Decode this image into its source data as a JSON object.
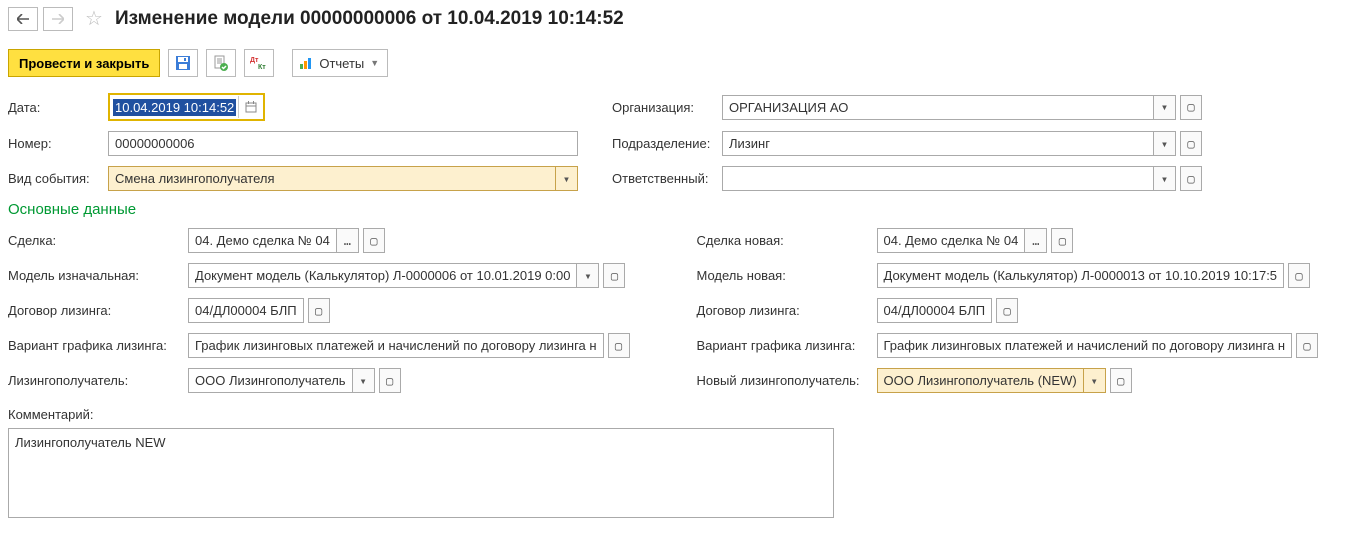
{
  "title": "Изменение модели 00000000006 от 10.04.2019 10:14:52",
  "toolbar": {
    "post_close": "Провести и закрыть",
    "reports": "Отчеты"
  },
  "top": {
    "date_label": "Дата:",
    "date_value": "10.04.2019 10:14:52",
    "number_label": "Номер:",
    "number_value": "00000000006",
    "event_label": "Вид события:",
    "event_value": "Смена лизингополучателя",
    "org_label": "Организация:",
    "org_value": "ОРГАНИЗАЦИЯ АО",
    "dept_label": "Подразделение:",
    "dept_value": "Лизинг",
    "resp_label": "Ответственный:",
    "resp_value": ""
  },
  "section": "Основные данные",
  "left": {
    "deal_label": "Сделка:",
    "deal_value": "04. Демо сделка № 04",
    "model_label": "Модель изначальная:",
    "model_value": "Документ модель (Калькулятор) Л-0000006 от 10.01.2019 0:00",
    "contract_label": "Договор лизинга:",
    "contract_value": "04/ДЛ00004 БЛП",
    "variant_label": "Вариант графика лизинга:",
    "variant_value": "График лизинговых платежей и начислений по договору лизинга н",
    "lessee_label": "Лизингополучатель:",
    "lessee_value": "ООО Лизингополучатель"
  },
  "right": {
    "deal_label": "Сделка новая:",
    "deal_value": "04. Демо сделка № 04",
    "model_label": "Модель новая:",
    "model_value": "Документ модель (Калькулятор) Л-0000013 от 10.10.2019 10:17:5",
    "contract_label": "Договор лизинга:",
    "contract_value": "04/ДЛ00004 БЛП",
    "variant_label": "Вариант графика лизинга:",
    "variant_value": "График лизинговых платежей и начислений по договору лизинга н",
    "lessee_label": "Новый лизингополучатель:",
    "lessee_value": "ООО Лизингополучатель (NEW)"
  },
  "comment_label": "Комментарий:",
  "comment_value": "Лизингополучатель NEW"
}
